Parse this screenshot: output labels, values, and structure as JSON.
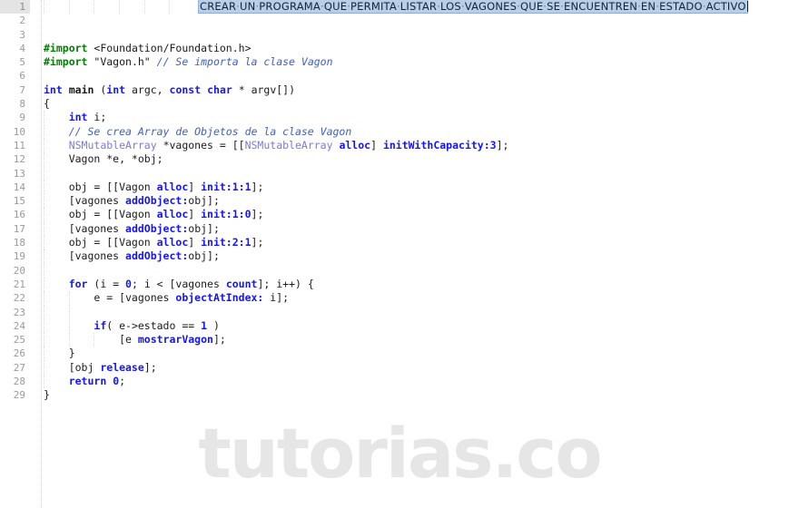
{
  "editor": {
    "title_line": {
      "text": "CREAR UN PROGRAMA QUE PERMITA LISTAR LOS VAGONES QUE SE ENCUENTREN EN ESTADO ACTIVO",
      "selected": true,
      "selection_bg": "#b9cfe8",
      "selection_fg": "#12233d",
      "space_marker": "·"
    },
    "watermark": "tutorias.co",
    "watermark_color": "#e6e6e6",
    "gutter": {
      "first_line": 1,
      "last_line": 29,
      "current_line": 1,
      "numbers": [
        "1",
        "2",
        "3",
        "4",
        "5",
        "6",
        "7",
        "8",
        "9",
        "10",
        "11",
        "12",
        "13",
        "14",
        "15",
        "16",
        "17",
        "18",
        "19",
        "20",
        "21",
        "22",
        "23",
        "24",
        "25",
        "26",
        "27",
        "28",
        "29"
      ]
    },
    "colors": {
      "background": "#ffffff",
      "keyword": "#1414ff",
      "preprocessor": "#008000",
      "comment": "#3f5fbf",
      "class_name": "#7b7bd6",
      "method": "#1414ff",
      "number": "#1414ff",
      "plain_text": "#1a1a1a",
      "line_number": "#9a9a9a",
      "current_line_gutter": "#e4e4e4",
      "indent_guide": "#dcdcdc"
    },
    "language": "Objective-C",
    "lines": [
      {
        "n": "1",
        "indent": 0,
        "kind": "title"
      },
      {
        "n": "2",
        "indent": 0,
        "kind": "blank"
      },
      {
        "n": "3",
        "indent": 0,
        "kind": "blank"
      },
      {
        "n": "4",
        "indent": 0,
        "kind": "code",
        "tokens": [
          {
            "t": "#import",
            "c": "pre"
          },
          {
            "t": " ",
            "c": "pl"
          },
          {
            "t": "<Foundation/Foundation.h>",
            "c": "hdr"
          }
        ]
      },
      {
        "n": "5",
        "indent": 0,
        "kind": "code",
        "tokens": [
          {
            "t": "#import",
            "c": "pre"
          },
          {
            "t": " ",
            "c": "pl"
          },
          {
            "t": "\"Vagon.h\"",
            "c": "hdr"
          },
          {
            "t": " ",
            "c": "pl"
          },
          {
            "t": "// Se importa la clase Vagon",
            "c": "cmt"
          }
        ]
      },
      {
        "n": "6",
        "indent": 0,
        "kind": "blank"
      },
      {
        "n": "7",
        "indent": 0,
        "kind": "code",
        "tokens": [
          {
            "t": "int",
            "c": "k"
          },
          {
            "t": " ",
            "c": "pl"
          },
          {
            "t": "main",
            "c": "fn"
          },
          {
            "t": " (",
            "c": "pl"
          },
          {
            "t": "int",
            "c": "k"
          },
          {
            "t": " argc, ",
            "c": "pl"
          },
          {
            "t": "const",
            "c": "k"
          },
          {
            "t": " ",
            "c": "pl"
          },
          {
            "t": "char",
            "c": "k"
          },
          {
            "t": " * argv[])",
            "c": "pl"
          }
        ]
      },
      {
        "n": "8",
        "indent": 0,
        "kind": "code",
        "tokens": [
          {
            "t": "{",
            "c": "pl"
          }
        ]
      },
      {
        "n": "9",
        "indent": 1,
        "kind": "code",
        "tokens": [
          {
            "t": "    ",
            "c": "pl"
          },
          {
            "t": "int",
            "c": "k"
          },
          {
            "t": " i;",
            "c": "pl"
          }
        ]
      },
      {
        "n": "10",
        "indent": 1,
        "kind": "code",
        "tokens": [
          {
            "t": "    ",
            "c": "pl"
          },
          {
            "t": "// Se crea Array de Objetos de la clase Vagon",
            "c": "cmt"
          }
        ]
      },
      {
        "n": "11",
        "indent": 1,
        "kind": "code",
        "tokens": [
          {
            "t": "    ",
            "c": "pl"
          },
          {
            "t": "NSMutableArray",
            "c": "cls"
          },
          {
            "t": " *vagones = [[",
            "c": "pl"
          },
          {
            "t": "NSMutableArray",
            "c": "cls"
          },
          {
            "t": " ",
            "c": "pl"
          },
          {
            "t": "alloc",
            "c": "msg"
          },
          {
            "t": "] ",
            "c": "pl"
          },
          {
            "t": "initWithCapacity:",
            "c": "msg"
          },
          {
            "t": "3",
            "c": "num"
          },
          {
            "t": "];",
            "c": "pl"
          }
        ]
      },
      {
        "n": "12",
        "indent": 1,
        "kind": "code",
        "tokens": [
          {
            "t": "    Vagon *e, *obj;",
            "c": "pl"
          }
        ]
      },
      {
        "n": "13",
        "indent": 1,
        "kind": "blank"
      },
      {
        "n": "14",
        "indent": 1,
        "kind": "code",
        "tokens": [
          {
            "t": "    obj = [[Vagon ",
            "c": "pl"
          },
          {
            "t": "alloc",
            "c": "msg"
          },
          {
            "t": "] ",
            "c": "pl"
          },
          {
            "t": "init:",
            "c": "msg"
          },
          {
            "t": "1",
            "c": "num"
          },
          {
            "t": ":",
            "c": "msg"
          },
          {
            "t": "1",
            "c": "num"
          },
          {
            "t": "];",
            "c": "pl"
          }
        ]
      },
      {
        "n": "15",
        "indent": 1,
        "kind": "code",
        "tokens": [
          {
            "t": "    [vagones ",
            "c": "pl"
          },
          {
            "t": "addObject:",
            "c": "msg"
          },
          {
            "t": "obj];",
            "c": "pl"
          }
        ]
      },
      {
        "n": "16",
        "indent": 1,
        "kind": "code",
        "tokens": [
          {
            "t": "    obj = [[Vagon ",
            "c": "pl"
          },
          {
            "t": "alloc",
            "c": "msg"
          },
          {
            "t": "] ",
            "c": "pl"
          },
          {
            "t": "init:",
            "c": "msg"
          },
          {
            "t": "1",
            "c": "num"
          },
          {
            "t": ":",
            "c": "msg"
          },
          {
            "t": "0",
            "c": "num"
          },
          {
            "t": "];",
            "c": "pl"
          }
        ]
      },
      {
        "n": "17",
        "indent": 1,
        "kind": "code",
        "tokens": [
          {
            "t": "    [vagones ",
            "c": "pl"
          },
          {
            "t": "addObject:",
            "c": "msg"
          },
          {
            "t": "obj];",
            "c": "pl"
          }
        ]
      },
      {
        "n": "18",
        "indent": 1,
        "kind": "code",
        "tokens": [
          {
            "t": "    obj = [[Vagon ",
            "c": "pl"
          },
          {
            "t": "alloc",
            "c": "msg"
          },
          {
            "t": "] ",
            "c": "pl"
          },
          {
            "t": "init:",
            "c": "msg"
          },
          {
            "t": "2",
            "c": "num"
          },
          {
            "t": ":",
            "c": "msg"
          },
          {
            "t": "1",
            "c": "num"
          },
          {
            "t": "];",
            "c": "pl"
          }
        ]
      },
      {
        "n": "19",
        "indent": 1,
        "kind": "code",
        "tokens": [
          {
            "t": "    [vagones ",
            "c": "pl"
          },
          {
            "t": "addObject:",
            "c": "msg"
          },
          {
            "t": "obj];",
            "c": "pl"
          }
        ]
      },
      {
        "n": "20",
        "indent": 1,
        "kind": "blank"
      },
      {
        "n": "21",
        "indent": 1,
        "kind": "code",
        "tokens": [
          {
            "t": "    ",
            "c": "pl"
          },
          {
            "t": "for",
            "c": "k"
          },
          {
            "t": " (i = ",
            "c": "pl"
          },
          {
            "t": "0",
            "c": "num"
          },
          {
            "t": "; i < [vagones ",
            "c": "pl"
          },
          {
            "t": "count",
            "c": "msg"
          },
          {
            "t": "]; i++) {",
            "c": "pl"
          }
        ]
      },
      {
        "n": "22",
        "indent": 2,
        "kind": "code",
        "tokens": [
          {
            "t": "        e = [vagones ",
            "c": "pl"
          },
          {
            "t": "objectAtIndex:",
            "c": "msg"
          },
          {
            "t": " i];",
            "c": "pl"
          }
        ]
      },
      {
        "n": "23",
        "indent": 2,
        "kind": "blank"
      },
      {
        "n": "24",
        "indent": 2,
        "kind": "code",
        "tokens": [
          {
            "t": "        ",
            "c": "pl"
          },
          {
            "t": "if",
            "c": "k"
          },
          {
            "t": "( e->estado == ",
            "c": "pl"
          },
          {
            "t": "1",
            "c": "num"
          },
          {
            "t": " )",
            "c": "pl"
          }
        ]
      },
      {
        "n": "25",
        "indent": 3,
        "kind": "code",
        "tokens": [
          {
            "t": "            [e ",
            "c": "pl"
          },
          {
            "t": "mostrarVagon",
            "c": "msg"
          },
          {
            "t": "];",
            "c": "pl"
          }
        ]
      },
      {
        "n": "26",
        "indent": 1,
        "kind": "code",
        "tokens": [
          {
            "t": "    }",
            "c": "pl"
          }
        ]
      },
      {
        "n": "27",
        "indent": 1,
        "kind": "code",
        "tokens": [
          {
            "t": "    [obj ",
            "c": "pl"
          },
          {
            "t": "release",
            "c": "msg"
          },
          {
            "t": "];",
            "c": "pl"
          }
        ]
      },
      {
        "n": "28",
        "indent": 1,
        "kind": "code",
        "tokens": [
          {
            "t": "    ",
            "c": "pl"
          },
          {
            "t": "return",
            "c": "k"
          },
          {
            "t": " ",
            "c": "pl"
          },
          {
            "t": "0",
            "c": "num"
          },
          {
            "t": ";",
            "c": "pl"
          }
        ]
      },
      {
        "n": "29",
        "indent": 0,
        "kind": "code",
        "tokens": [
          {
            "t": "}",
            "c": "pl"
          }
        ]
      }
    ]
  }
}
